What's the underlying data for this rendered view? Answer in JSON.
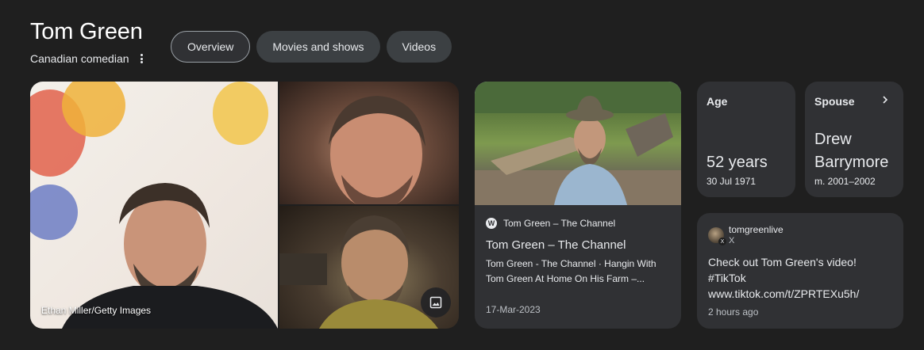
{
  "header": {
    "title": "Tom Green",
    "subtitle": "Canadian comedian",
    "more_icon": "more-vert-icon"
  },
  "tabs": [
    {
      "label": "Overview",
      "active": true
    },
    {
      "label": "Movies and shows",
      "active": false
    },
    {
      "label": "Videos",
      "active": false
    }
  ],
  "images": {
    "main_caption": "Ethan Miller/Getty Images",
    "more_images_icon": "image-gallery-icon"
  },
  "channel_card": {
    "source": "Tom Green – The Channel",
    "source_icon": "wordpress-icon",
    "title": "Tom Green – The Channel",
    "description": "Tom Green - The Channel · Hangin With Tom Green At Home On His Farm –...",
    "date": "17-Mar-2023"
  },
  "facts": {
    "age": {
      "label": "Age",
      "value": "52 years",
      "sub": "30 Jul 1971"
    },
    "spouse": {
      "label": "Spouse",
      "value_line1": "Drew",
      "value_line2": "Barrymore",
      "sub": "m. 2001–2002",
      "icon": "chevron-right-icon"
    }
  },
  "social_post": {
    "handle": "tomgreenlive",
    "network": "X",
    "text_line1": "Check out Tom Green's video!",
    "text_line2": "#TikTok",
    "text_line3": "www.tiktok.com/t/ZPRTEXu5h/",
    "time": "2 hours ago"
  },
  "colors": {
    "background": "#1f1f1f",
    "card": "#303134",
    "chip": "#3c4043",
    "text": "#e8eaed"
  }
}
